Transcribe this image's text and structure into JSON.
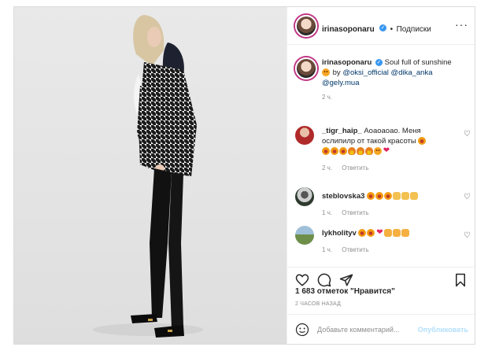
{
  "header": {
    "username": "irinasoponaru",
    "separator": "•",
    "follow_label": "Подписки"
  },
  "caption": {
    "username": "irinasoponaru",
    "text": "Soul full of sunshine",
    "by": "by",
    "mentions": [
      "@oksi_official",
      "@dika_anka",
      "@gely.mua"
    ],
    "time": "2 ч."
  },
  "comments": [
    {
      "username": "_tigr_haip_",
      "text_line1": "Аоаоаоао. Меня",
      "text_line2": "ослипилр от такой красоты",
      "emoji": [
        "face",
        "face",
        "face",
        "fire",
        "fire",
        "fire",
        "face",
        "heart"
      ],
      "time": "2 ч.",
      "reply_label": "Ответить"
    },
    {
      "username": "steblovska3",
      "emoji": [
        "face",
        "face",
        "face",
        "clap",
        "clap",
        "clap"
      ],
      "time": "1 ч.",
      "reply_label": "Ответить"
    },
    {
      "username": "lykholityv",
      "emoji": [
        "face",
        "face",
        "heart",
        "hug",
        "hug",
        "hug"
      ],
      "time": "1 ч.",
      "reply_label": "Ответить"
    }
  ],
  "likes": "1 683 отметок \"Нравится\"",
  "time_ago": "2 ЧАСОВ НАЗАД",
  "add_comment": {
    "placeholder": "Добавьте комментарий...",
    "publish_label": "Опубликовать"
  },
  "icons": {
    "more": "more-icon",
    "like": "heart-icon",
    "comment": "comment-icon",
    "share": "share-icon",
    "save": "bookmark-icon",
    "emoji": "smiley-icon"
  },
  "colors": {
    "verified": "#3897f0",
    "mention": "#00376b",
    "publish": "#b2dffc",
    "muted": "#8e8e8e"
  }
}
